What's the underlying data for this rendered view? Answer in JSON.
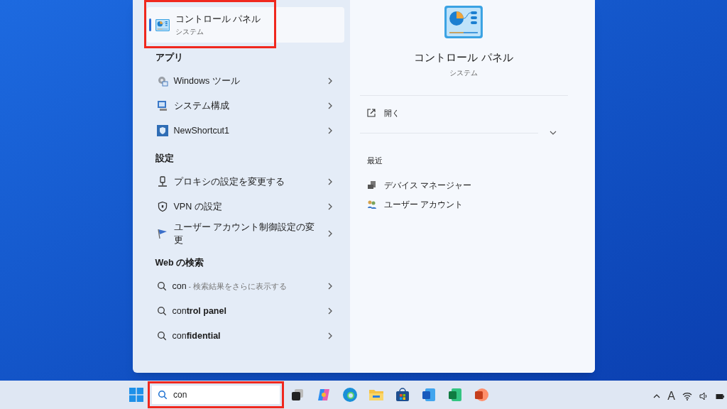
{
  "top_result": {
    "title": "コントロール パネル",
    "subtitle": "システム",
    "selected": true,
    "annotated": true
  },
  "sections": [
    {
      "heading": "アプリ",
      "items": [
        {
          "label": "Windows ツール",
          "kind": "tools"
        },
        {
          "label": "システム構成",
          "kind": "computer"
        },
        {
          "label": "NewShortcut1",
          "kind": "shield"
        }
      ]
    },
    {
      "heading": "設定",
      "items": [
        {
          "label": "プロキシの設定を変更する",
          "kind": "proxy"
        },
        {
          "label": "VPN の設定",
          "kind": "vpn"
        },
        {
          "label": "ユーザー アカウント制御設定の変更",
          "kind": "flag"
        }
      ]
    },
    {
      "heading": "Web の検索",
      "items": [
        {
          "label": "con",
          "hint": "- 検索結果をさらに表示する",
          "kind": "search"
        },
        {
          "label": "con**trol panel**",
          "kind": "search"
        },
        {
          "label": "con**fidential**",
          "kind": "search"
        }
      ]
    }
  ],
  "detail": {
    "title": "コントロール パネル",
    "subtitle": "システム",
    "actions": [
      {
        "label": "開く"
      }
    ],
    "recent_heading": "最近",
    "recent": [
      {
        "label": "デバイス マネージャー",
        "kind": "device"
      },
      {
        "label": "ユーザー アカウント",
        "kind": "users"
      }
    ]
  },
  "taskbar": {
    "search": {
      "value": "con",
      "annotated": true
    },
    "apps": [
      {
        "kind": "start"
      },
      {
        "kind": "taskview"
      },
      {
        "kind": "copilot"
      },
      {
        "kind": "edge"
      },
      {
        "kind": "folder"
      },
      {
        "kind": "store"
      },
      {
        "kind": "word"
      },
      {
        "kind": "excel"
      },
      {
        "kind": "powerpoint"
      }
    ],
    "tray": {
      "ime": "A"
    }
  }
}
